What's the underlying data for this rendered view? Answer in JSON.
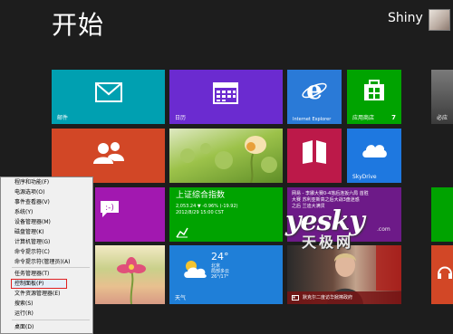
{
  "screen": {
    "title": "开始"
  },
  "user": {
    "name": "Shiny"
  },
  "tiles": {
    "mail": {
      "label": "邮件"
    },
    "calendar": {
      "label": "日历"
    },
    "ie": {
      "label": "Internet Explorer"
    },
    "store": {
      "label": "应用商店",
      "badge": "7"
    },
    "edge1": {
      "label": "必应"
    },
    "reader": {
      "label": ""
    },
    "skydrive": {
      "label": "SkyDrive"
    },
    "finance": {
      "title": "上证综合指数",
      "value": "2,053.24 ▼ -0.96% (-19.92)",
      "time": "2012/8/29 15:00 CST"
    },
    "news": {
      "headline": "网易 - 李娜大赛0-4落后连扳六局 首胜",
      "line2": "大赛 苏利亚新高之后大战3盘迷惑",
      "line3": "之后 兰迪大满贯"
    },
    "weather": {
      "temp": "24°",
      "city": "北京",
      "condition": "局部多云",
      "range": "26°/17°",
      "label": "天气"
    },
    "newspic": {
      "caption": "默克尔二度访华掀擦政府"
    }
  },
  "watermark": {
    "main": "yesky",
    "sub": "天极网",
    "url": ".com"
  },
  "context_menu": {
    "items": [
      "程序和功能(F)",
      "电源选项(O)",
      "事件查看器(V)",
      "系统(Y)",
      "设备管理器(M)",
      "磁盘管理(K)",
      "计算机管理(G)",
      "命令提示符(C)",
      "命令提示符(管理员)(A)",
      "任务管理器(T)",
      "控制面板(P)",
      "文件资源管理器(E)",
      "搜索(S)",
      "运行(R)",
      "桌面(D)"
    ],
    "selected_index": 10
  }
}
